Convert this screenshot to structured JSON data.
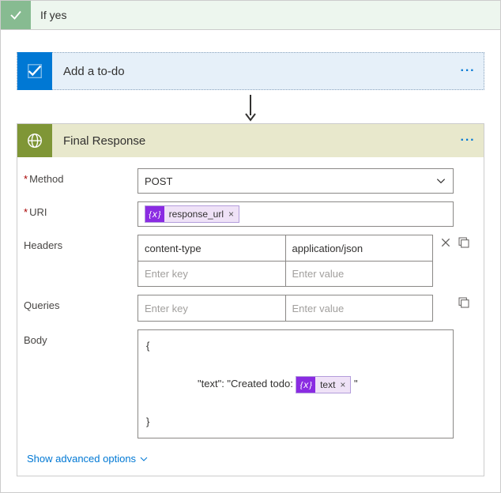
{
  "condition": {
    "title": "If yes"
  },
  "step1": {
    "title": "Add a to-do"
  },
  "arrow": true,
  "step2": {
    "title": "Final Response",
    "method": {
      "label": "Method",
      "value": "POST"
    },
    "uri": {
      "label": "URI",
      "token": "response_url"
    },
    "headers": {
      "label": "Headers",
      "rows": [
        {
          "key": "content-type",
          "value": "application/json"
        }
      ],
      "placeholders": {
        "key": "Enter key",
        "value": "Enter value"
      }
    },
    "queries": {
      "label": "Queries",
      "placeholders": {
        "key": "Enter key",
        "value": "Enter value"
      }
    },
    "body": {
      "label": "Body",
      "prefix_line": "{",
      "line2_prefix": "  \"text\": \"Created todo: ",
      "token": "text",
      "line2_suffix": " \"",
      "suffix_line": "}"
    },
    "advanced_link": "Show advanced options"
  }
}
